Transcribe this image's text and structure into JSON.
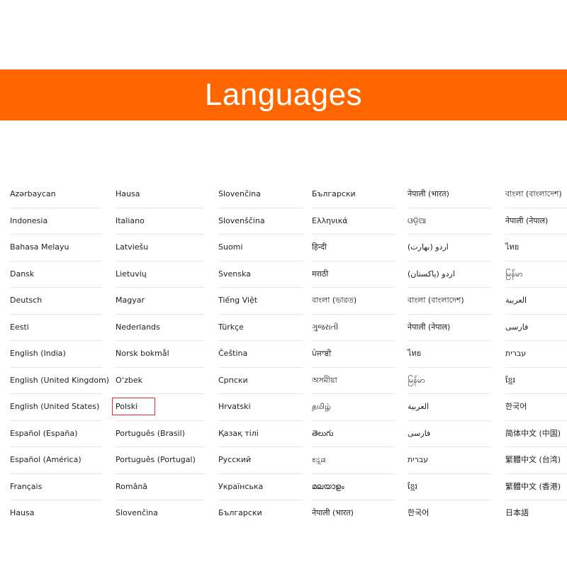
{
  "header": {
    "title": "Languages",
    "color": "#FF6600"
  },
  "selected": {
    "column": 1,
    "index": 8,
    "border_color": "#e03030"
  },
  "columns": [
    [
      "Azərbaycan",
      "Indonesia",
      "Bahasa Melayu",
      "Dansk",
      "Deutsch",
      "Eesti",
      "English (India)",
      "English (United Kingdom)",
      "English (United States)",
      "Español (España)",
      "Español (América)",
      "Français",
      "Hausa"
    ],
    [
      "Hausa",
      "Italiano",
      "Latviešu",
      "Lietuvių",
      "Magyar",
      "Nederlands",
      "Norsk bokmål",
      "O‘zbek",
      "Polski",
      "Português (Brasil)",
      "Português (Portugal)",
      "Română",
      "Slovenčina"
    ],
    [
      "Slovenčina",
      "Slovenščina",
      "Suomi",
      "Svenska",
      "Tiếng Việt",
      "Türkçe",
      "Čeština",
      "Српски",
      "Hrvatski",
      "Қазақ тілі",
      "Русский",
      "Українська",
      "Български"
    ],
    [
      "Български",
      "Ελληνικά",
      "हिन्दी",
      "मराठी",
      "বাংলা (ভারত)",
      "ગુજરાતી",
      "ਪੰਜਾਬੀ",
      "অসমীয়া",
      "தமிழ்",
      "తెలుగు",
      "ಕನ್ನಡ",
      "മലയാളം",
      "नेपाली (भारत)"
    ],
    [
      "नेपाली (भारत)",
      "ଓଡ଼ିଆ",
      "اردو (بھارت)",
      "اردو (پاکستان)",
      "বাংলা (বাংলাদেশ)",
      "नेपाली (नेपाल)",
      "ไทย",
      "မြန်မာ",
      "العربية",
      "فارسی",
      "עברית",
      "ខ្មែរ",
      "한국어"
    ],
    [
      "বাংলা (বাংলাদেশ)",
      "नेपाली (नेपाल)",
      "ไทย",
      "မြန်မာ",
      "العربية",
      "فارسی",
      "עברית",
      "ខ្មែរ",
      "한국어",
      "简体中文 (中国)",
      "繁體中文 (台湾)",
      "繁體中文 (香港)",
      "日本語"
    ]
  ]
}
